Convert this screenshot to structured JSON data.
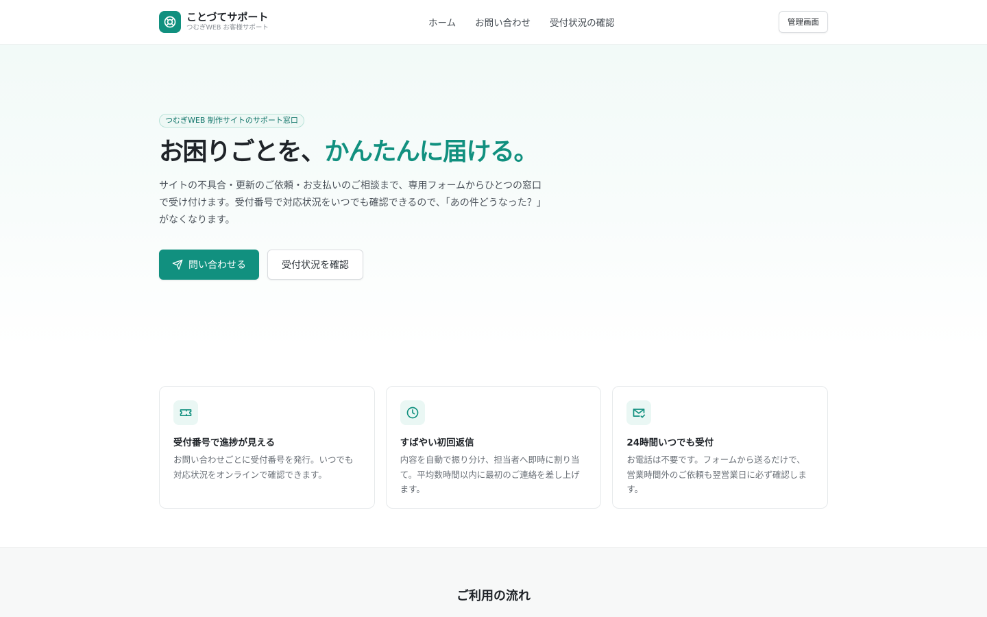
{
  "header": {
    "brand_name": "ことづてサポート",
    "brand_sub": "つむぎWEB お客様サポート",
    "nav": [
      {
        "label": "ホーム"
      },
      {
        "label": "お問い合わせ"
      },
      {
        "label": "受付状況の確認"
      }
    ],
    "admin_label": "管理画面"
  },
  "hero": {
    "pill": "つむぎWEB 制作サイトのサポート窓口",
    "title_main": "お困りごとを、",
    "title_accent": "かんたんに届ける。",
    "description": "サイトの不具合・更新のご依頼・お支払いのご相談まで、専用フォームからひとつの窓口で受け付けます。受付番号で対応状況をいつでも確認できるので、「あの件どうなった？」がなくなります。",
    "primary_label": "問い合わせる",
    "secondary_label": "受付状況を確認"
  },
  "features": [
    {
      "icon": "ticket-icon",
      "title": "受付番号で進捗が見える",
      "text": "お問い合わせごとに受付番号を発行。いつでも対応状況をオンラインで確認できます。"
    },
    {
      "icon": "clock-icon",
      "title": "すばやい初回返信",
      "text": "内容を自動で振り分け、担当者へ即時に割り当て。平均数時間以内に最初のご連絡を差し上げます。"
    },
    {
      "icon": "mail-check-icon",
      "title": "24時間いつでも受付",
      "text": "お電話は不要です。フォームから送るだけで、営業時間外のご依頼も翌営業日に必ず確認します。"
    }
  ],
  "flow": {
    "title": "ご利用の流れ"
  },
  "colors": {
    "accent": "#11907f",
    "text": "#1f2328"
  }
}
